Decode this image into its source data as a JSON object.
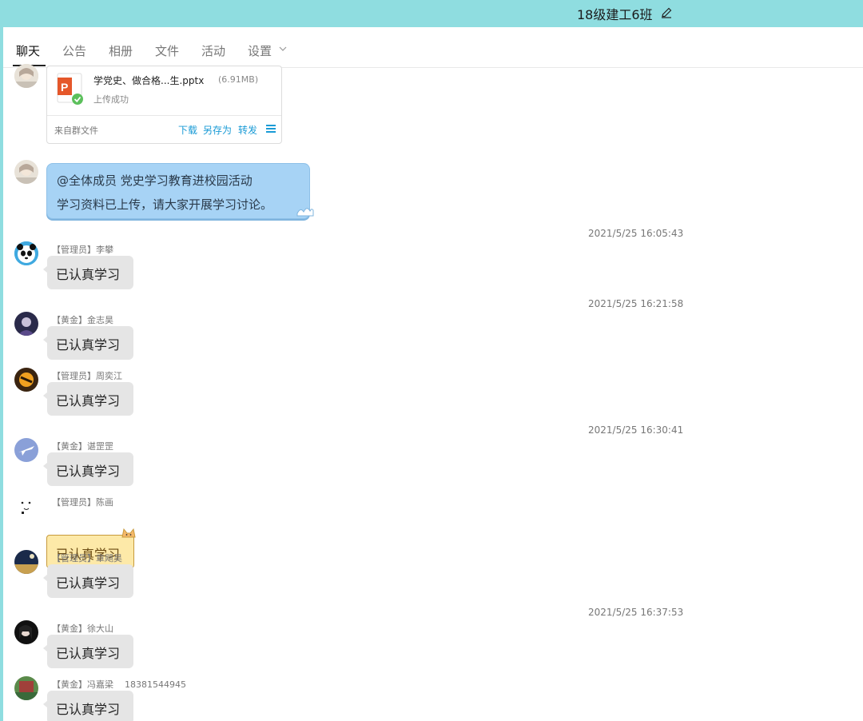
{
  "window": {
    "title": "18级建工6班"
  },
  "tabs": [
    {
      "label": "聊天"
    },
    {
      "label": "公告"
    },
    {
      "label": "相册"
    },
    {
      "label": "文件"
    },
    {
      "label": "活动"
    },
    {
      "label": "设置"
    }
  ],
  "file_message": {
    "file_name": "学党史、做合格...生.pptx",
    "file_size": "(6.91MB)",
    "status": "上传成功",
    "source": "来自群文件",
    "actions": {
      "download": "下载",
      "save_as": "另存为",
      "forward": "转发"
    }
  },
  "announcement": {
    "line1": "@全体成员 党史学习教育进校园活动",
    "line2": "学习资料已上传，请大家开展学习讨论。"
  },
  "timestamps": [
    "2021/5/25 16:05:43",
    "2021/5/25 16:21:58",
    "2021/5/25 16:30:41",
    "2021/5/25 16:37:53"
  ],
  "messages": [
    {
      "sender": "【管理员】李攀",
      "text": "已认真学习"
    },
    {
      "sender": "【黄金】金志昊",
      "text": "已认真学习"
    },
    {
      "sender": "【管理员】周奕江",
      "text": "已认真学习"
    },
    {
      "sender": "【黄金】谌罡罡",
      "text": "已认真学习"
    },
    {
      "sender": "【管理员】陈画",
      "text": "已认真学习"
    },
    {
      "sender": "【管理员】章飓昊",
      "text": "已认真学习"
    },
    {
      "sender": "【黄金】徐大山",
      "text": "已认真学习"
    },
    {
      "sender": "【黄金】冯嘉梁",
      "sender_extra": "18381544945",
      "text": "已认真学习"
    }
  ],
  "colors": {
    "titlebar": "#8fdde0",
    "accent_link": "#1a9bd6",
    "bubble_gray": "#e5e5e5",
    "bubble_blue": "#a7d3f5",
    "bubble_yellow": "#fde9a8"
  }
}
